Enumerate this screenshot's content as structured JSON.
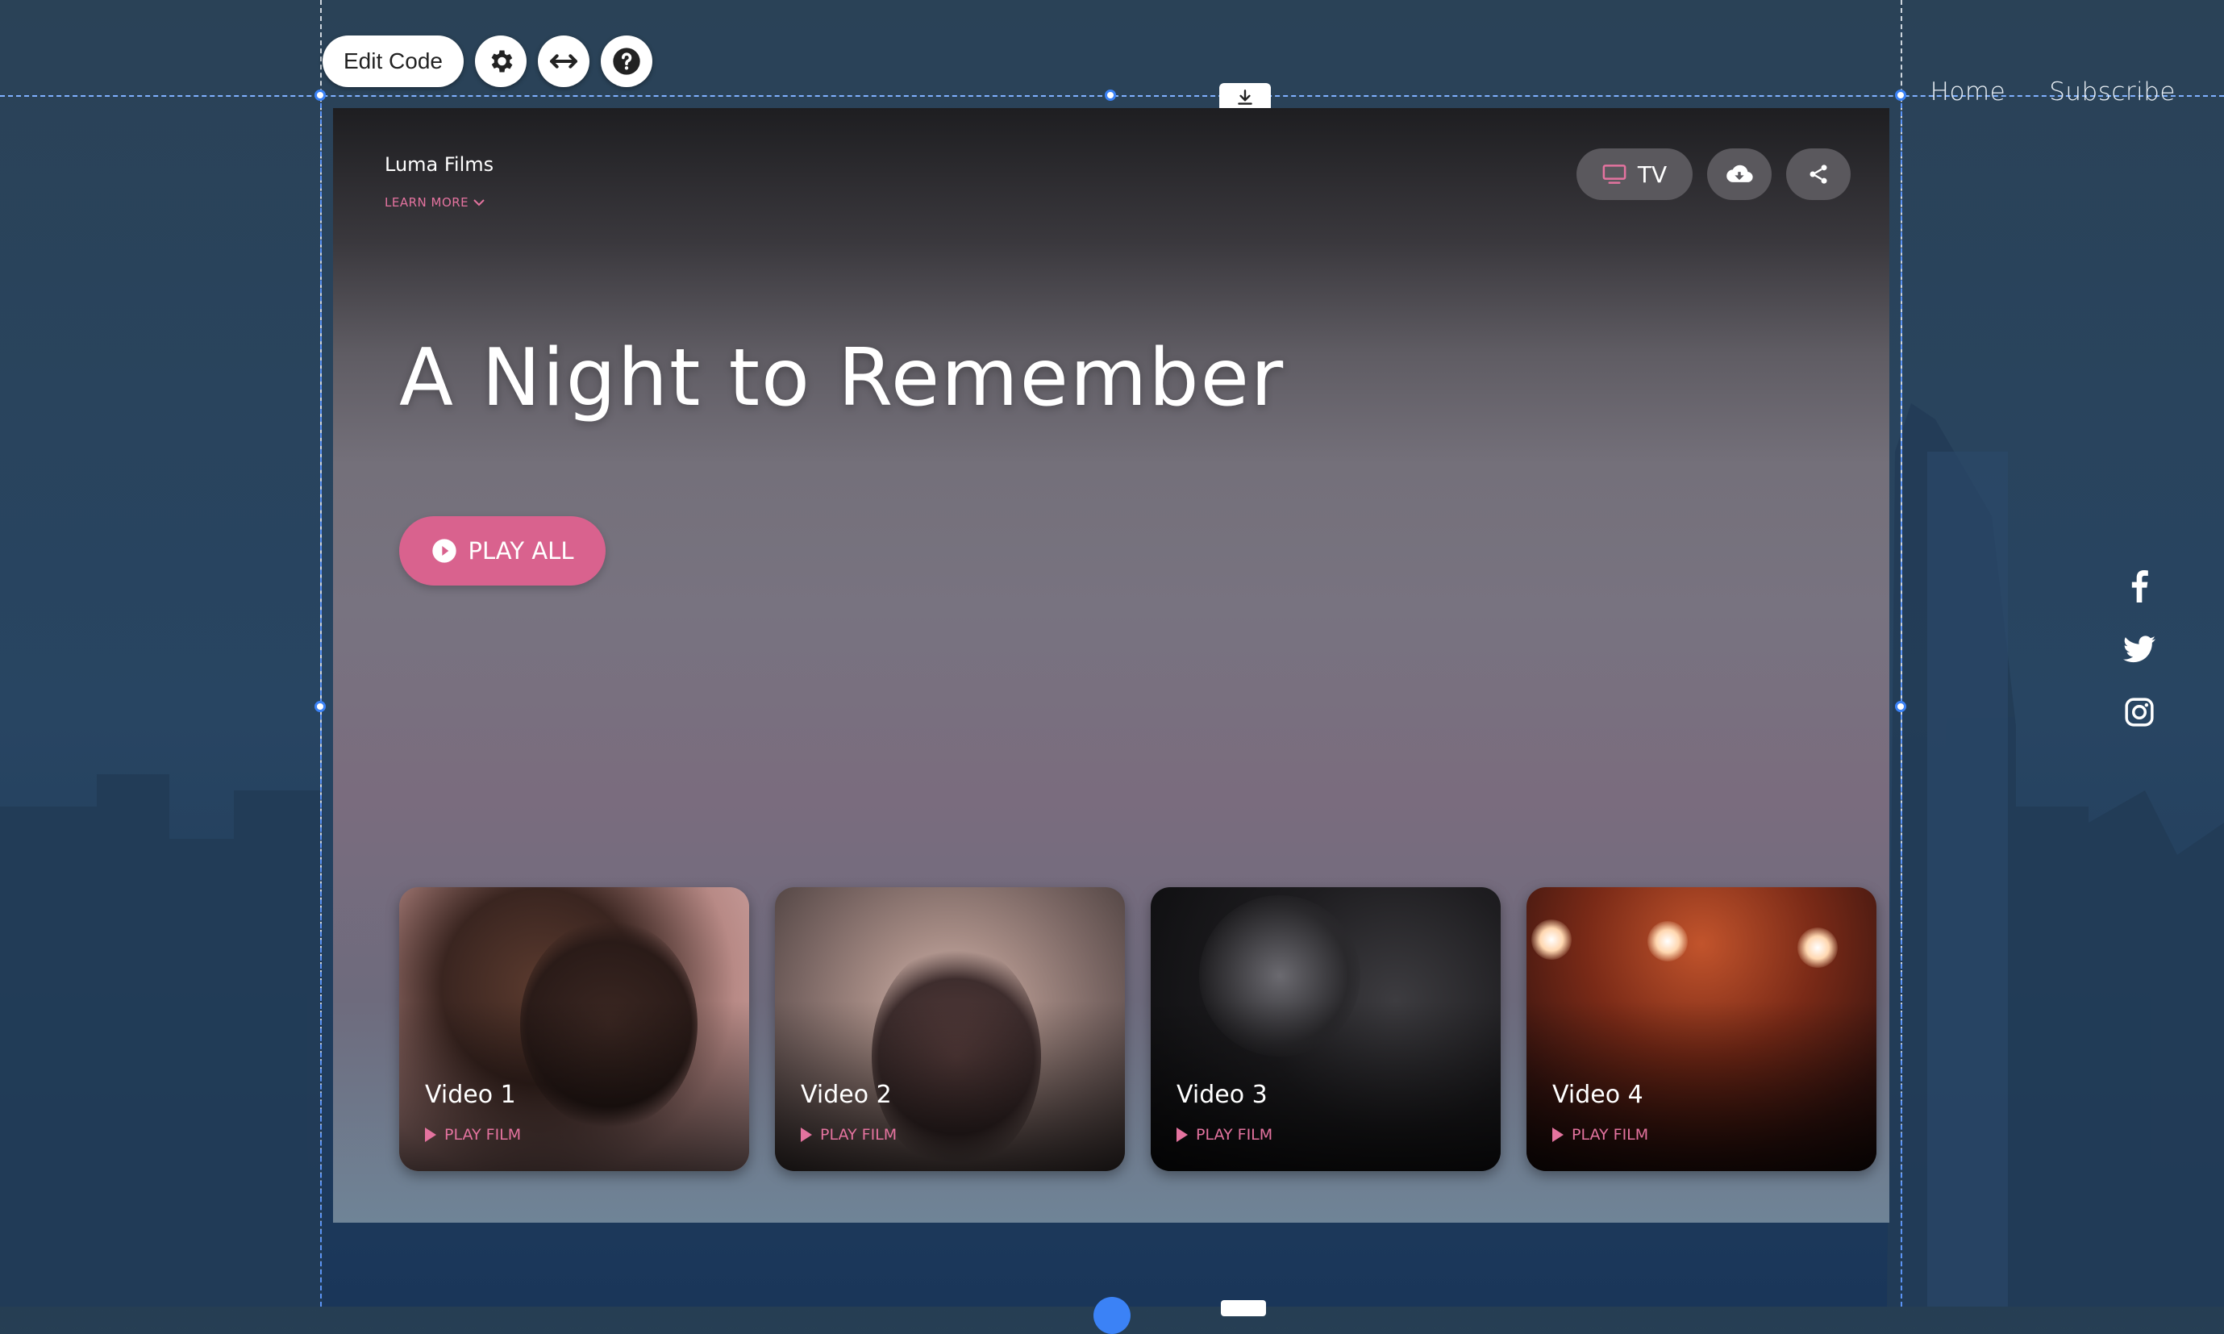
{
  "editor": {
    "edit_code_label": "Edit Code",
    "tool_icons": [
      "gear-icon",
      "arrows-horizontal-icon",
      "question-icon"
    ],
    "download_icon": "download-icon"
  },
  "site": {
    "nav": [
      "Home",
      "Subscribe"
    ],
    "social": [
      "facebook-icon",
      "twitter-icon",
      "instagram-icon"
    ]
  },
  "app": {
    "brand": "Luma Films",
    "learn_more": "LEARN MORE",
    "tv_label": "TV",
    "hero_title": "A Night to Remember",
    "play_all": "PLAY ALL",
    "videos": [
      {
        "title": "Video 1",
        "action": "PLAY FILM"
      },
      {
        "title": "Video 2",
        "action": "PLAY FILM"
      },
      {
        "title": "Video 3",
        "action": "PLAY FILM"
      },
      {
        "title": "Video 4",
        "action": "PLAY FILM"
      }
    ]
  },
  "colors": {
    "accent": "#d9628e",
    "accent_text": "#e4739f",
    "selection": "#3b82f6"
  }
}
